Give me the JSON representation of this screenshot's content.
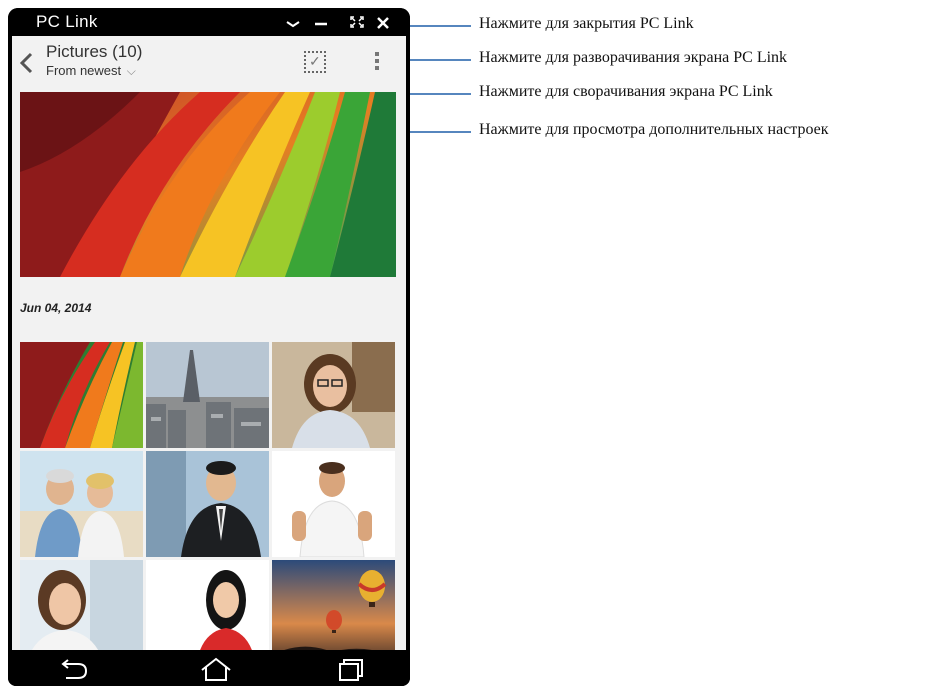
{
  "window": {
    "title": "PC Link",
    "controls": [
      "chevron-down-icon",
      "minimize-icon",
      "maximize-icon",
      "close-icon"
    ]
  },
  "app": {
    "header": {
      "title": "Pictures (10)",
      "sort_label": "From newest",
      "sort_arrow": "⌵"
    },
    "date_group": "Jun 04,  2014",
    "thumbnails": [
      "rainbow-paper",
      "paris-city",
      "woman-glasses",
      "senior-couple",
      "businessman",
      "man-white-shirt",
      "smiling-woman",
      "asian-woman",
      "hot-air-balloons"
    ]
  },
  "navbar": [
    "back-icon",
    "home-icon",
    "recent-apps-icon"
  ],
  "callouts": [
    "Нажмите для закрытия PC Link",
    "Нажмите для разворачивания экрана PC Link",
    "Нажмите для сворачивания экрана PC Link",
    "Нажмите для просмотра дополнительных настроек"
  ],
  "colors": {
    "accent_blue": "#1f5fa8",
    "window_bg": "#000000",
    "app_bg": "#f2f2f2"
  }
}
